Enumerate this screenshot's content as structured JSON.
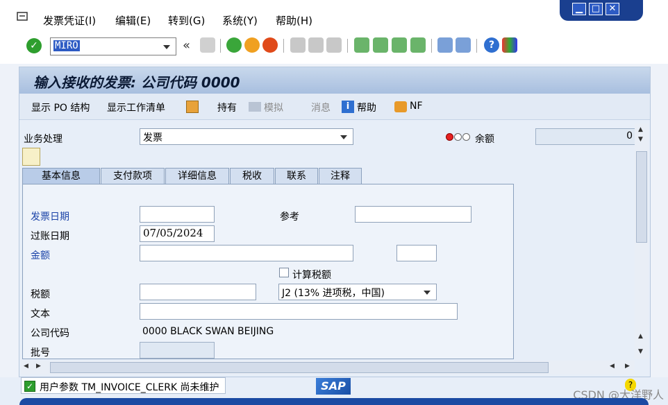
{
  "menu": {
    "items": [
      {
        "label": "发票凭证(I)"
      },
      {
        "label": "编辑(E)"
      },
      {
        "label": "转到(G)"
      },
      {
        "label": "系统(Y)"
      },
      {
        "label": "帮助(H)"
      }
    ]
  },
  "toolbar": {
    "command_value": "MIRO",
    "nav_back_symbol": "«"
  },
  "screen": {
    "title": "输入接收的发票: 公司代码 0000",
    "app_toolbar": {
      "show_po_structure": "显示 PO 结构",
      "show_worklist": "显示工作清单",
      "hold": "持有",
      "simulate": "模拟",
      "messages": "消息",
      "help": "帮助",
      "nf": "NF"
    }
  },
  "form": {
    "transaction_label": "业务处理",
    "transaction_value": "发票",
    "balance_label": "余额",
    "balance_value": "0",
    "tabs": [
      {
        "label": "基本信息",
        "active": true
      },
      {
        "label": "支付款项"
      },
      {
        "label": "详细信息"
      },
      {
        "label": "税收"
      },
      {
        "label": "联系"
      },
      {
        "label": "注释"
      }
    ],
    "invoice_date_label": "发票日期",
    "invoice_date_value": "",
    "reference_label": "参考",
    "reference_value": "",
    "posting_date_label": "过账日期",
    "posting_date_value": "07/05/2024",
    "amount_label": "金额",
    "amount_value": "",
    "currency_value": "",
    "calc_tax_label": "计算税额",
    "calc_tax_checked": false,
    "tax_amount_label": "税额",
    "tax_amount_value": "",
    "tax_code_value": "J2 (13% 进项税，中国)",
    "text_label": "文本",
    "text_value": "",
    "company_code_label": "公司代码",
    "company_code_value": "0000 BLACK SWAN BEIJING",
    "batch_label": "批号",
    "batch_value": ""
  },
  "status": {
    "message": "用户参数 TM_INVOICE_CLERK 尚未维护",
    "sap_logo": "SAP",
    "watermark": "CSDN @大洋野人"
  },
  "colors": {
    "accent": "#1b4aa3",
    "label_blue": "#1b43a8",
    "title_bg": "#a8bfdf",
    "ok_green": "#2e9e2e"
  }
}
